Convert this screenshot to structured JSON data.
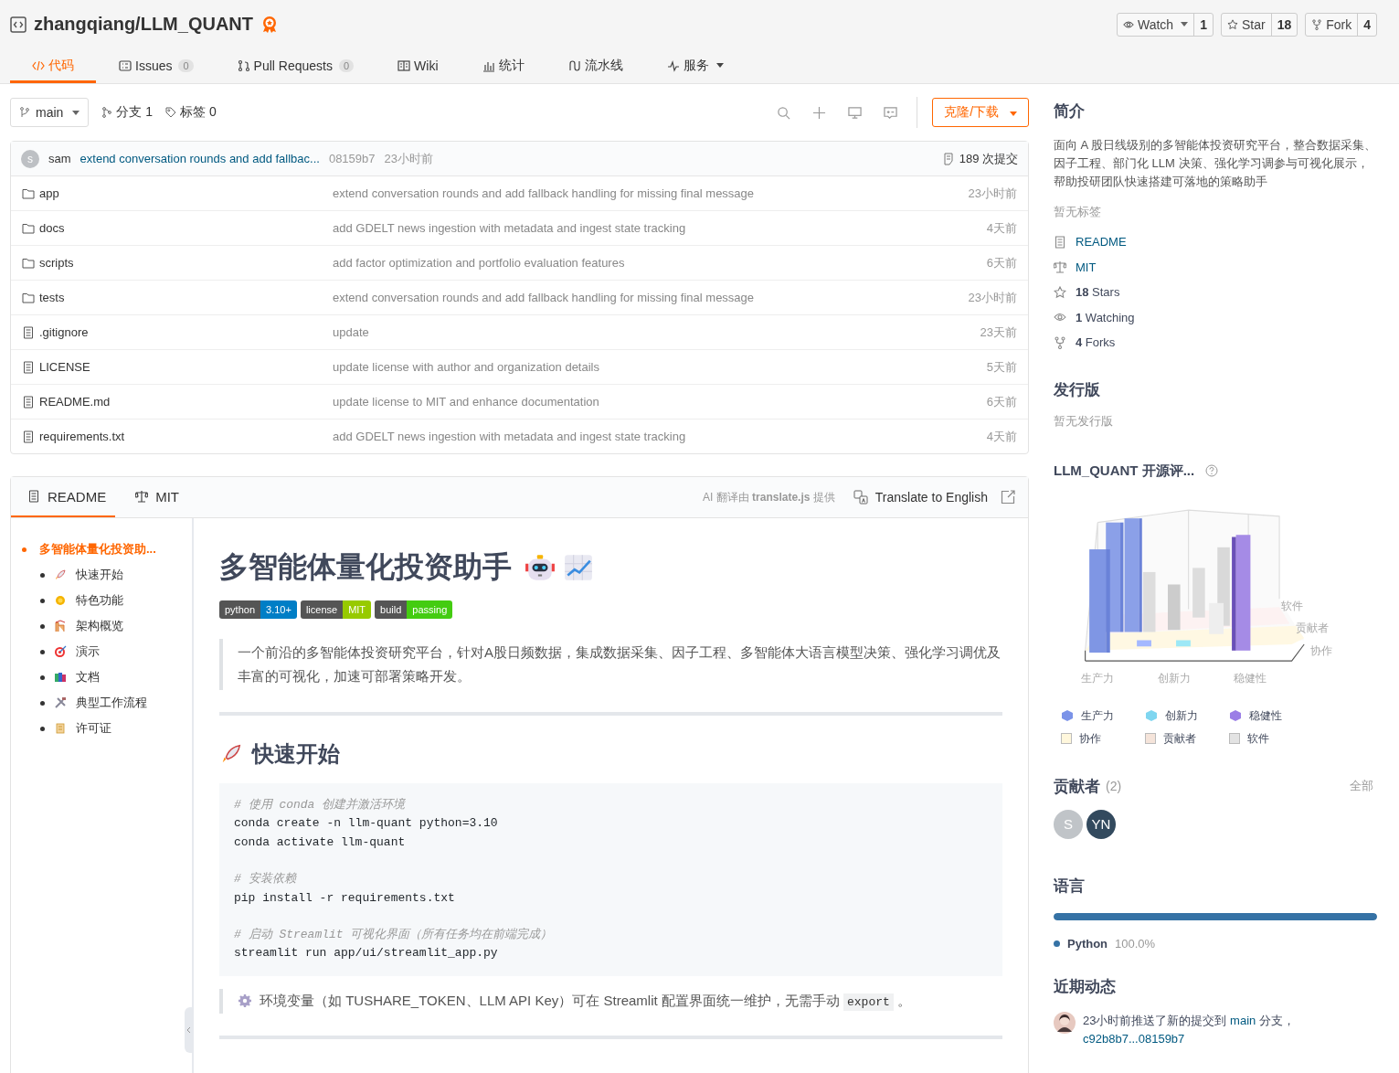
{
  "repo": {
    "title": "zhangqiang/LLM_QUANT"
  },
  "social": [
    {
      "kind": "watch",
      "label": "Watch",
      "count": "1",
      "dropdown": true
    },
    {
      "kind": "star",
      "label": "Star",
      "count": "18",
      "dropdown": false
    },
    {
      "kind": "fork",
      "label": "Fork",
      "count": "4",
      "dropdown": false
    }
  ],
  "nav_tabs": [
    {
      "kind": "code",
      "label": "代码",
      "selected": true
    },
    {
      "kind": "issues",
      "label": "Issues",
      "count": "0",
      "selected": false
    },
    {
      "kind": "pr",
      "label": "Pull Requests",
      "count": "0",
      "selected": false
    },
    {
      "kind": "wiki",
      "label": "Wiki",
      "selected": false
    },
    {
      "kind": "stats",
      "label": "统计",
      "selected": false
    },
    {
      "kind": "pipeline",
      "label": "流水线",
      "selected": false
    },
    {
      "kind": "service",
      "label": "服务",
      "selected": false
    }
  ],
  "toolbar": {
    "branch": "main",
    "branches": "分支 1",
    "tags": "标签 0",
    "clone_button": "克隆/下载"
  },
  "last_commit": {
    "avatar": "s",
    "author": "sam",
    "message": "extend conversation rounds and add fallbac...",
    "hash": "08159b7",
    "time": "23小时前",
    "count": "189 次提交"
  },
  "files": [
    {
      "kind": "folder",
      "name": "app",
      "message": "extend conversation rounds and add fallback handling for missing final message",
      "time": "23小时前"
    },
    {
      "kind": "folder",
      "name": "docs",
      "message": "add GDELT news ingestion with metadata and ingest state tracking",
      "time": "4天前"
    },
    {
      "kind": "folder",
      "name": "scripts",
      "message": "add factor optimization and portfolio evaluation features",
      "time": "6天前"
    },
    {
      "kind": "folder",
      "name": "tests",
      "message": "extend conversation rounds and add fallback handling for missing final message",
      "time": "23小时前"
    },
    {
      "kind": "file",
      "name": ".gitignore",
      "message": "update",
      "time": "23天前"
    },
    {
      "kind": "file",
      "name": "LICENSE",
      "message": "update license with author and organization details",
      "time": "5天前"
    },
    {
      "kind": "file",
      "name": "README.md",
      "message": "update license to MIT and enhance documentation",
      "time": "6天前"
    },
    {
      "kind": "file",
      "name": "requirements.txt",
      "message": "add GDELT news ingestion with metadata and ingest state tracking",
      "time": "4天前"
    }
  ],
  "readme_tabs": [
    {
      "kind": "readme",
      "label": "README",
      "selected": true
    },
    {
      "kind": "license",
      "label": "MIT",
      "selected": false
    }
  ],
  "translate": {
    "credit": "AI 翻译由 **translate.js** 提供",
    "button": "Translate to English"
  },
  "toc": [
    {
      "label": "多智能体量化投资助...",
      "selected": true,
      "children": [
        {
          "label": "快速开始",
          "selected": false
        },
        {
          "label": "特色功能",
          "selected": false
        },
        {
          "label": "架构概览",
          "selected": false
        },
        {
          "label": "演示",
          "selected": false
        },
        {
          "label": "文档",
          "selected": false
        },
        {
          "label": "典型工作流程",
          "selected": false
        },
        {
          "label": "许可证",
          "selected": false
        }
      ]
    }
  ],
  "readme": {
    "title": "多智能体量化投资助手",
    "badges": [
      {
        "label": "python",
        "value": "3.10+",
        "color": "#007ec6"
      },
      {
        "label": "license",
        "value": "MIT",
        "color": "#97ca00"
      },
      {
        "label": "build",
        "value": "passing",
        "color": "#4c1"
      }
    ],
    "quote": "一个前沿的多智能体投资研究平台，针对A股日频数据，集成数据采集、因子工程、多智能体大语言模型决策、强化学习调优及丰富的可视化，加速可部署策略开发。",
    "section_title": "快速开始",
    "code_groups": [
      {
        "comment": "# 使用 conda 创建并激活环境",
        "lines": [
          "conda create -n llm-quant python=3.10",
          "conda activate llm-quant"
        ]
      },
      {
        "comment": "# 安装依赖",
        "lines": [
          "pip install -r requirements.txt"
        ]
      },
      {
        "comment": "# 启动 Streamlit 可视化界面（所有任务均在前端完成）",
        "lines": [
          "streamlit run app/ui/streamlit_app.py"
        ]
      }
    ],
    "note": {
      "text": "环境变量（如 TUSHARE_TOKEN、LLM API Key）可在 Streamlit 配置界面统一维护，无需手动",
      "code": "export",
      "end": "。"
    }
  },
  "sidebar": {
    "about_title": "简介",
    "description": "面向 A 股日线级别的多智能体投资研究平台，整合数据采集、因子工程、部门化 LLM 决策、强化学习调参与可视化展示，帮助投研团队快速搭建可落地的策略助手",
    "no_tags": "暂无标签",
    "links": [
      {
        "kind": "readme",
        "text": "README"
      },
      {
        "kind": "license",
        "text": "MIT"
      },
      {
        "kind": "stars",
        "text": "**18** Stars"
      },
      {
        "kind": "watching",
        "text": "**1** Watching"
      },
      {
        "kind": "forks",
        "text": "**4** Forks"
      }
    ],
    "releases_title": "发行版",
    "no_releases": "暂无发行版",
    "eval_title": "LLM_QUANT 开源评...",
    "eval_axes": {
      "x": [
        "生产力",
        "创新力",
        "稳健性"
      ],
      "depth": [
        "软件",
        "贡献者",
        "协作"
      ]
    },
    "eval_legend": [
      {
        "kind": "cube",
        "label": "生产力",
        "color": "#7b93e8"
      },
      {
        "kind": "cube",
        "label": "创新力",
        "color": "#7fd6f0"
      },
      {
        "kind": "cube",
        "label": "稳健性",
        "color": "#9b7ee6"
      },
      {
        "kind": "square",
        "label": "协作",
        "color": "#fff7dc"
      },
      {
        "kind": "square",
        "label": "贡献者",
        "color": "#f5e4da"
      },
      {
        "kind": "square",
        "label": "软件",
        "color": "#e3e3e3"
      }
    ],
    "contributors_title": "贡献者",
    "contributors_count": "(2)",
    "contributors_all": "全部",
    "contributors": [
      {
        "initials": "S",
        "color": "#c0c4c8"
      },
      {
        "initials": "YN",
        "color": "#334a5e"
      }
    ],
    "languages_title": "语言",
    "languages": [
      {
        "name": "Python",
        "percent": "100.0%",
        "level": 1.0,
        "color": "#3572a5"
      }
    ],
    "activity_title": "近期动态",
    "activity": {
      "prefix": "23小时前推送了新的提交到",
      "branch": "main",
      "middle": "分支，",
      "commits": "c92b8b7...08159b7"
    }
  }
}
